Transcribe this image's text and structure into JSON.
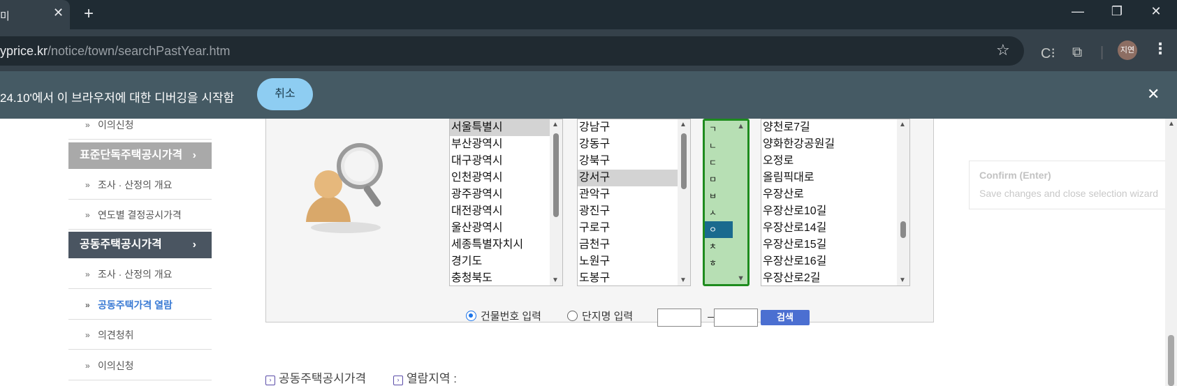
{
  "browser": {
    "tab_title": "미",
    "tab_close": "✕",
    "new_tab": "+",
    "url_host": "yprice.kr",
    "url_path": "/notice/town/searchPastYear.htm",
    "avatar_text": "지연",
    "window_controls": [
      "—",
      "❐",
      "✕"
    ]
  },
  "infobar": {
    "message": "24.10'에서 이 브라우저에 대한 디버깅을 시작함",
    "cancel_label": "취소",
    "close": "✕"
  },
  "sidebar": {
    "items": [
      {
        "label": "이의신청",
        "type": "item"
      },
      {
        "label": "표준단독주택공시가격",
        "type": "head-gray"
      },
      {
        "label": "조사 · 산정의 개요",
        "type": "item"
      },
      {
        "label": "연도별 결정공시가격",
        "type": "item"
      },
      {
        "label": "공동주택공시가격",
        "type": "head-dark"
      },
      {
        "label": "조사 · 산정의 개요",
        "type": "item"
      },
      {
        "label": "공동주택가격 열람",
        "type": "item-active"
      },
      {
        "label": "의견청취",
        "type": "item"
      },
      {
        "label": "이의신청",
        "type": "item"
      }
    ]
  },
  "lists": {
    "sido": [
      "서울특별시",
      "부산광역시",
      "대구광역시",
      "인천광역시",
      "광주광역시",
      "대전광역시",
      "울산광역시",
      "세종특별자치시",
      "경기도",
      "충청북도"
    ],
    "sido_selected": 0,
    "gu": [
      "강남구",
      "강동구",
      "강북구",
      "강서구",
      "관악구",
      "광진구",
      "구로구",
      "금천구",
      "노원구",
      "도봉구"
    ],
    "gu_selected": 3,
    "chosung": [
      "ㄱ",
      "ㄴ",
      "ㄷ",
      "ㅁ",
      "ㅂ",
      "ㅅ",
      "ㅇ",
      "ㅊ",
      "ㅎ"
    ],
    "chosung_selected": 6,
    "roads": [
      "양천로7길",
      "양화한강공원길",
      "오정로",
      "올림픽대로",
      "우장산로",
      "우장산로10길",
      "우장산로14길",
      "우장산로15길",
      "우장산로16길",
      "우장산로2길"
    ]
  },
  "search": {
    "radio_building": "건물번호 입력",
    "radio_complex": "단지명 입력",
    "dash": "－",
    "button": "검색"
  },
  "bottom": {
    "link1": "공동주택공시가격",
    "link2": "열람지역 :"
  },
  "confirm": {
    "title": "Confirm (Enter)",
    "subtitle": "Save changes and close selection wizard"
  }
}
